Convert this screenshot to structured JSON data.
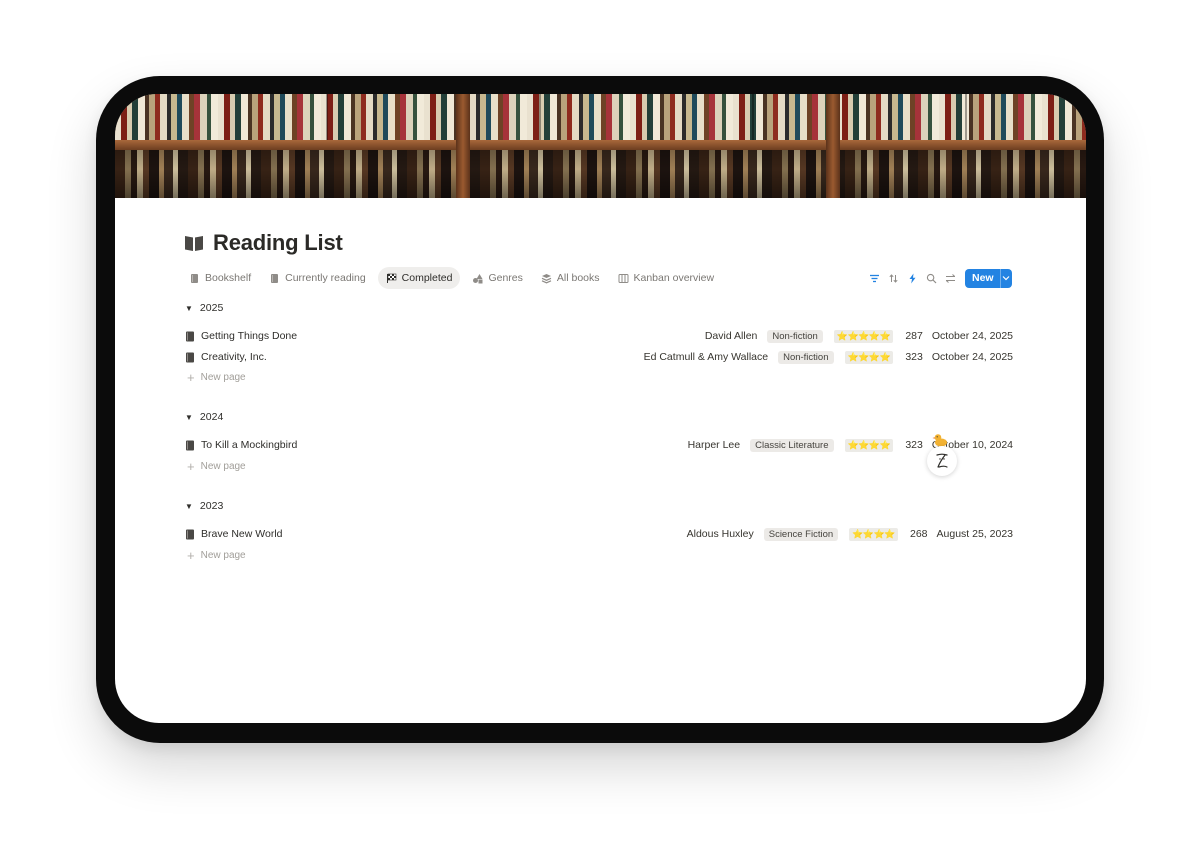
{
  "page": {
    "title": "Reading List"
  },
  "tabs": [
    {
      "label": "Bookshelf",
      "icon": "book-icon",
      "active": false
    },
    {
      "label": "Currently reading",
      "icon": "book-icon",
      "active": false
    },
    {
      "label": "Completed",
      "icon": "checkered-flag-icon",
      "active": true
    },
    {
      "label": "Genres",
      "icon": "shapes-icon",
      "active": false
    },
    {
      "label": "All books",
      "icon": "layers-icon",
      "active": false
    },
    {
      "label": "Kanban overview",
      "icon": "columns-icon",
      "active": false
    }
  ],
  "toolbar": {
    "new_label": "New"
  },
  "colors": {
    "accent": "#2383e2",
    "star": "#f2c230"
  },
  "groups": [
    {
      "label": "2025",
      "rows": [
        {
          "name": "Getting Things Done",
          "author": "David Allen",
          "genre": "Non-fiction",
          "rating": "⭐⭐⭐⭐⭐",
          "pages": "287",
          "date": "October 24, 2025"
        },
        {
          "name": "Creativity, Inc.",
          "author": "Ed Catmull & Amy Wallace",
          "genre": "Non-fiction",
          "rating": "⭐⭐⭐⭐",
          "pages": "323",
          "date": "October 24, 2025"
        }
      ],
      "new_page_label": "New page"
    },
    {
      "label": "2024",
      "rows": [
        {
          "name": "To Kill a Mockingbird",
          "author": "Harper Lee",
          "genre": "Classic Literature",
          "rating": "⭐⭐⭐⭐",
          "pages": "323",
          "date": "October 10, 2024"
        }
      ],
      "new_page_label": "New page"
    },
    {
      "label": "2023",
      "rows": [
        {
          "name": "Brave New World",
          "author": "Aldous Huxley",
          "genre": "Science Fiction",
          "rating": "⭐⭐⭐⭐",
          "pages": "268",
          "date": "August 25, 2023"
        }
      ],
      "new_page_label": "New page"
    }
  ]
}
